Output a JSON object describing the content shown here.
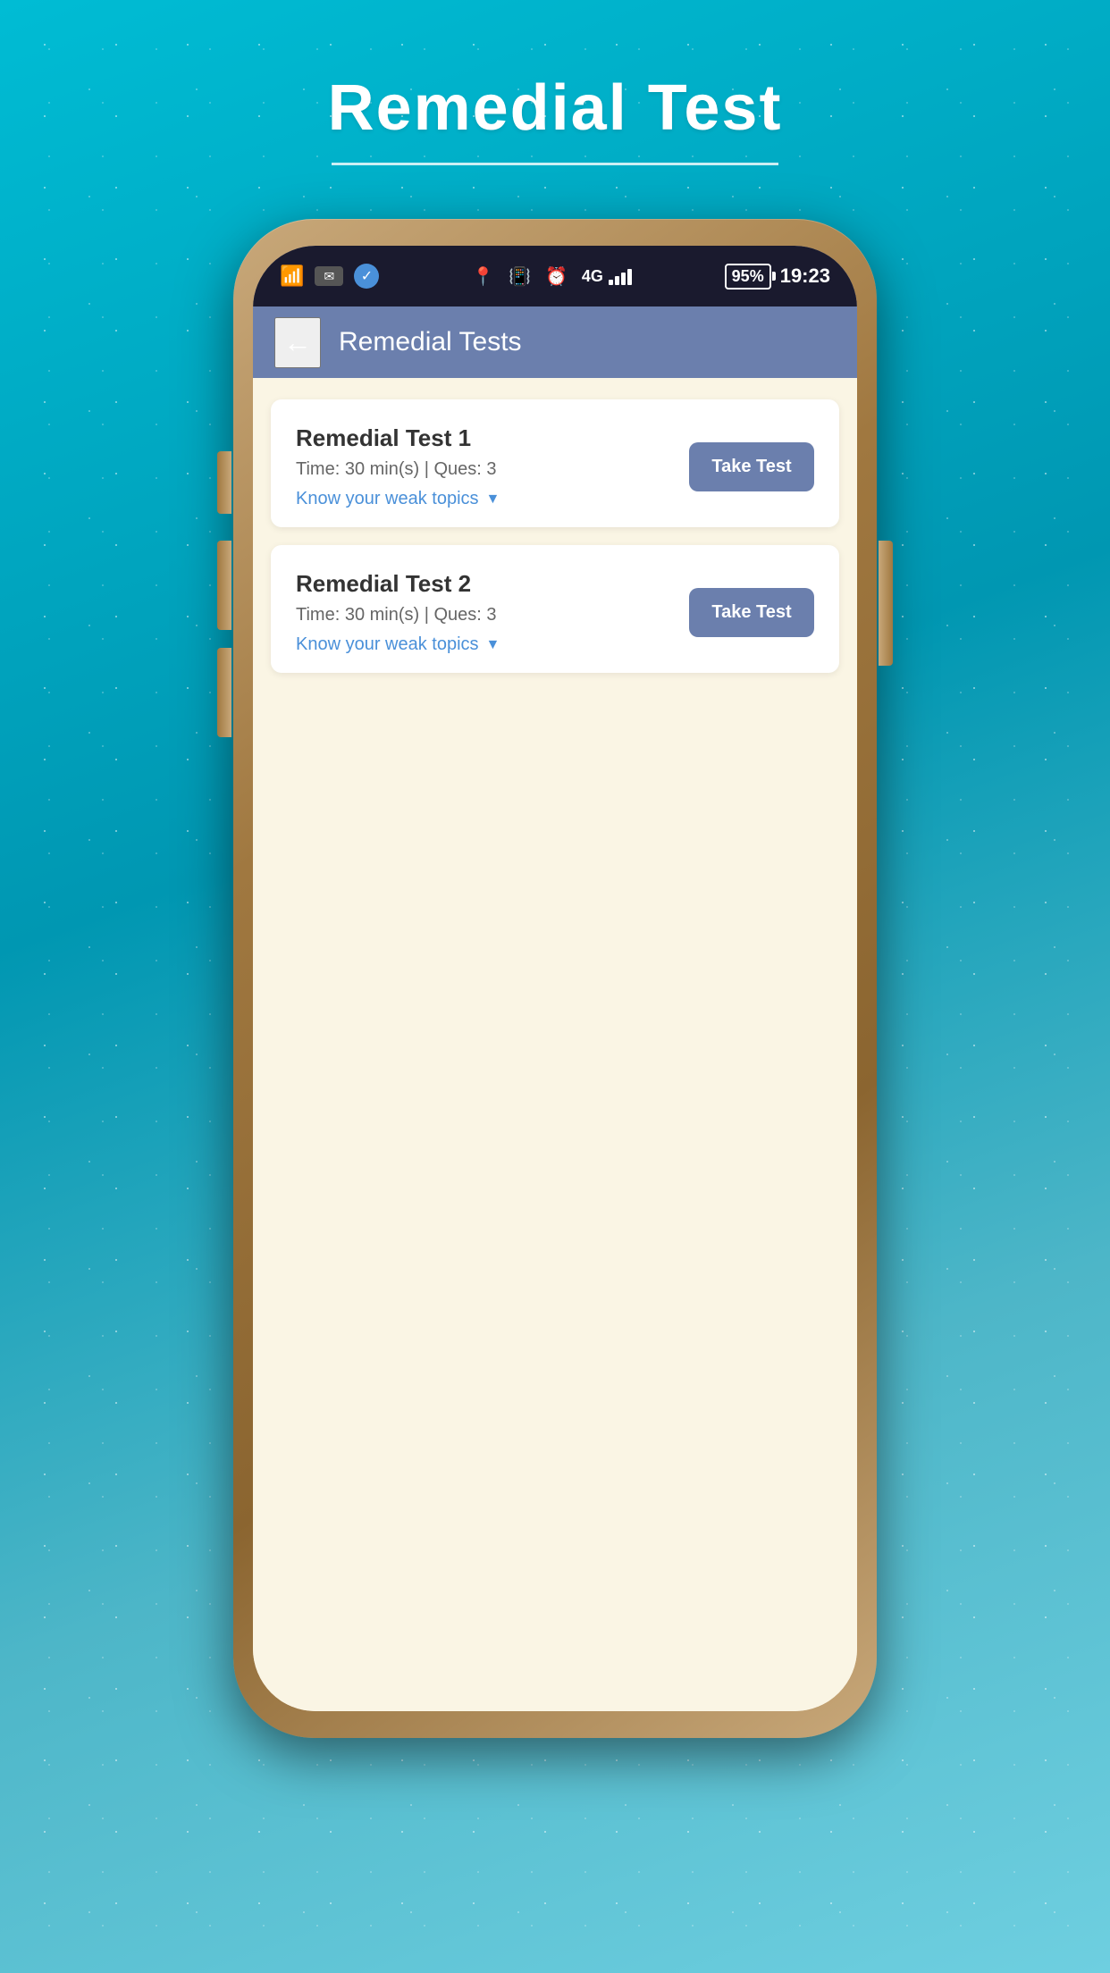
{
  "page": {
    "title": "Remedial Test",
    "underline": true,
    "background_color": "#00bcd4"
  },
  "status_bar": {
    "time": "19:23",
    "battery_percent": "95%",
    "signal_4g": "4G",
    "icons": {
      "wifi": "📶",
      "notification": "✉",
      "check": "✓",
      "location": "📍",
      "vibrate": "📳",
      "alarm": "⏰"
    }
  },
  "header": {
    "title": "Remedial Tests",
    "back_label": "←"
  },
  "tests": [
    {
      "id": 1,
      "name": "Remedial Test 1",
      "time": "Time: 30 min(s) | Ques: 3",
      "weak_topics_label": "Know your weak topics",
      "button_label": "Take Test"
    },
    {
      "id": 2,
      "name": "Remedial Test 2",
      "time": "Time: 30 min(s) | Ques: 3",
      "weak_topics_label": "Know your weak topics",
      "button_label": "Take Test"
    }
  ],
  "colors": {
    "header_bg": "#6b7fad",
    "button_bg": "#6b7fad",
    "link_color": "#4a90d9",
    "content_bg": "#faf5e4",
    "card_bg": "#ffffff",
    "status_bar_bg": "#1a1a2e"
  }
}
